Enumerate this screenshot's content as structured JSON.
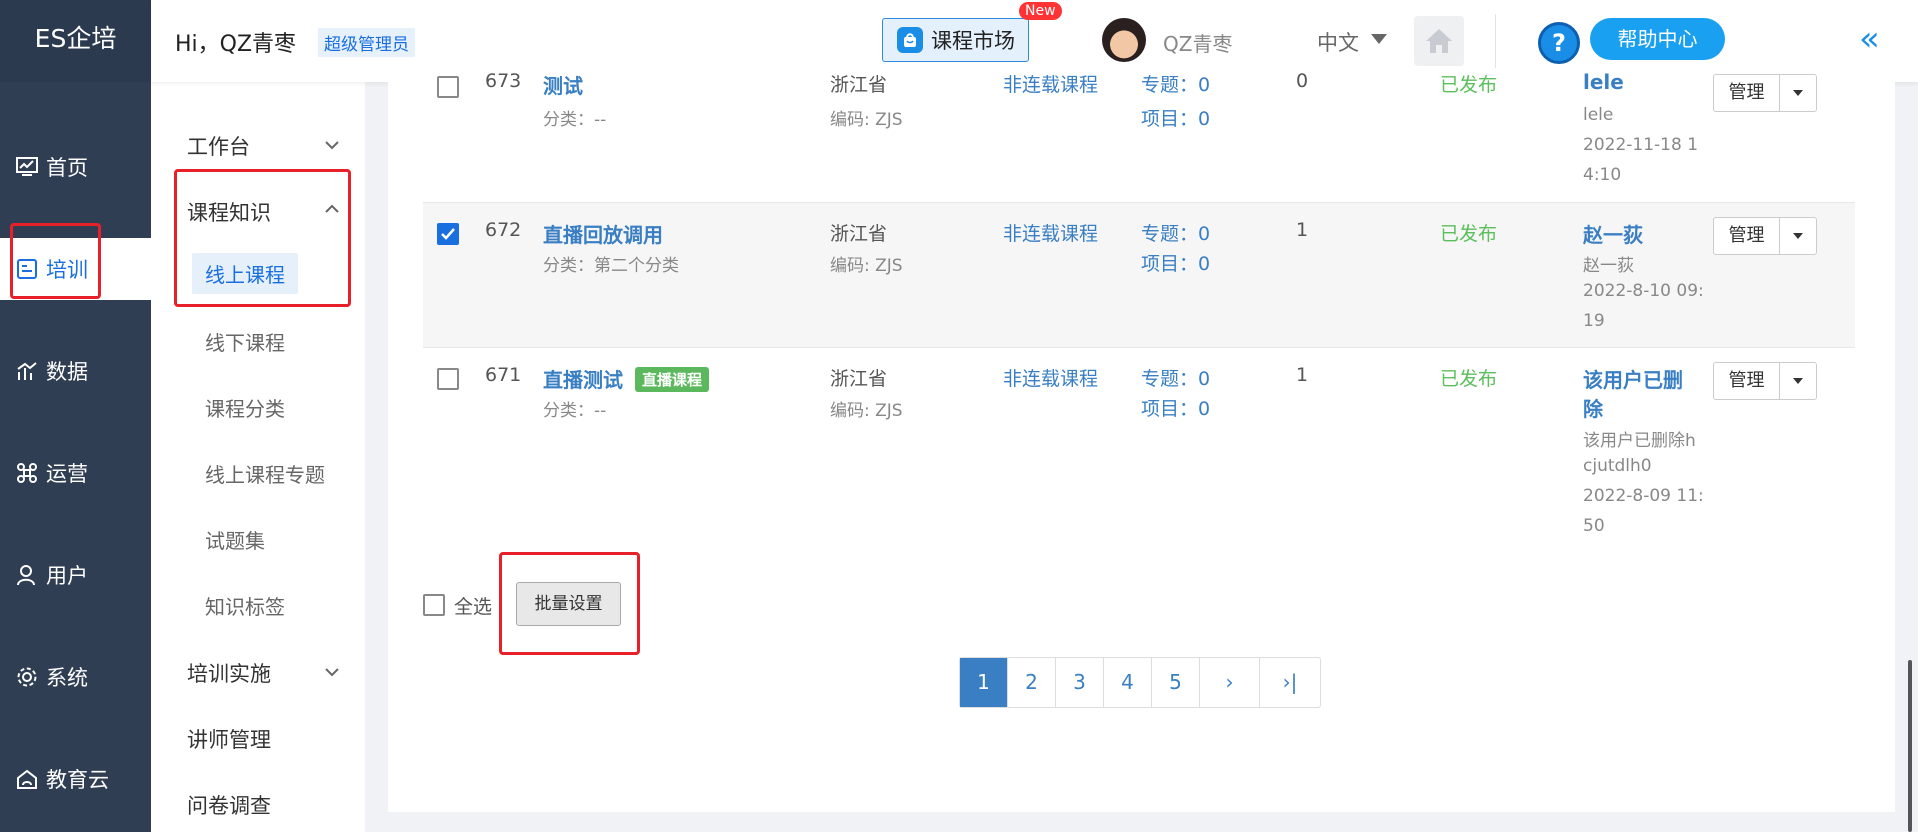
{
  "app": {
    "logo": "ES企培"
  },
  "header": {
    "greeting": "Hi，QZ青枣",
    "role": "超级管理员",
    "market_label": "课程市场",
    "new_badge": "New",
    "user_name": "QZ青枣",
    "language": "中文",
    "help_label": "帮助中心",
    "help_symbol": "?",
    "collapse_symbol": "«"
  },
  "nav1": {
    "items": [
      {
        "label": "首页",
        "icon": "dashboard-icon"
      },
      {
        "label": "培训",
        "icon": "training-icon",
        "active": true
      },
      {
        "label": "数据",
        "icon": "chart-icon"
      },
      {
        "label": "运营",
        "icon": "operations-icon"
      },
      {
        "label": "用户",
        "icon": "user-icon"
      },
      {
        "label": "系统",
        "icon": "gear-icon"
      },
      {
        "label": "教育云",
        "icon": "cloud-icon"
      }
    ]
  },
  "nav2": {
    "groups": [
      {
        "label": "工作台"
      },
      {
        "label": "课程知识"
      },
      {
        "label": "培训实施"
      },
      {
        "label": "讲师管理"
      },
      {
        "label": "问卷调查"
      }
    ],
    "subitems": [
      {
        "label": "线上课程",
        "active": true
      },
      {
        "label": "线下课程"
      },
      {
        "label": "课程分类"
      },
      {
        "label": "线上课程专题"
      },
      {
        "label": "试题集"
      },
      {
        "label": "知识标签"
      }
    ]
  },
  "rows": [
    {
      "id": "673",
      "checked": false,
      "title": "测试",
      "category": "分类：--",
      "province": "浙江省",
      "code": "编码: ZJS",
      "serial": "非连载课程",
      "topic_label": "专题：",
      "topic_count": "0",
      "project_label": "项目：",
      "project_count": "0",
      "count": "0",
      "status": "已发布",
      "creator": "lele",
      "creator_sub": "lele",
      "date1": "2022-11-18 1",
      "date2": "4:10",
      "manage": "管理"
    },
    {
      "id": "672",
      "checked": true,
      "title": "直播回放调用",
      "category": "分类：第二个分类",
      "province": "浙江省",
      "code": "编码: ZJS",
      "serial": "非连载课程",
      "topic_label": "专题：",
      "topic_count": "0",
      "project_label": "项目：",
      "project_count": "0",
      "count": "1",
      "status": "已发布",
      "creator": "赵一荻",
      "creator_sub": "赵一荻",
      "date1": "2022-8-10 09:",
      "date2": "19",
      "manage": "管理"
    },
    {
      "id": "671",
      "checked": false,
      "title": "直播测试",
      "tag": "直播课程",
      "category": "分类：--",
      "province": "浙江省",
      "code": "编码: ZJS",
      "serial": "非连载课程",
      "topic_label": "专题：",
      "topic_count": "0",
      "project_label": "项目：",
      "project_count": "0",
      "count": "1",
      "status": "已发布",
      "creator": "该用户已删",
      "creator2": "除",
      "creator_sub": "该用户已删除h",
      "creator_sub2": "cjutdlh0",
      "date1": "2022-8-09 11:",
      "date2": "50",
      "manage": "管理"
    }
  ],
  "footer": {
    "select_all": "全选",
    "batch_label": "批量设置"
  },
  "pager": {
    "pages": [
      "1",
      "2",
      "3",
      "4",
      "5"
    ],
    "next": "›",
    "last": "›|",
    "current": "1"
  },
  "colors": {
    "accent": "#1a6fe0",
    "link": "#3a7fc4",
    "published": "#5bbf5b",
    "highlight": "#e8202a",
    "nav_bg": "#303e54"
  }
}
